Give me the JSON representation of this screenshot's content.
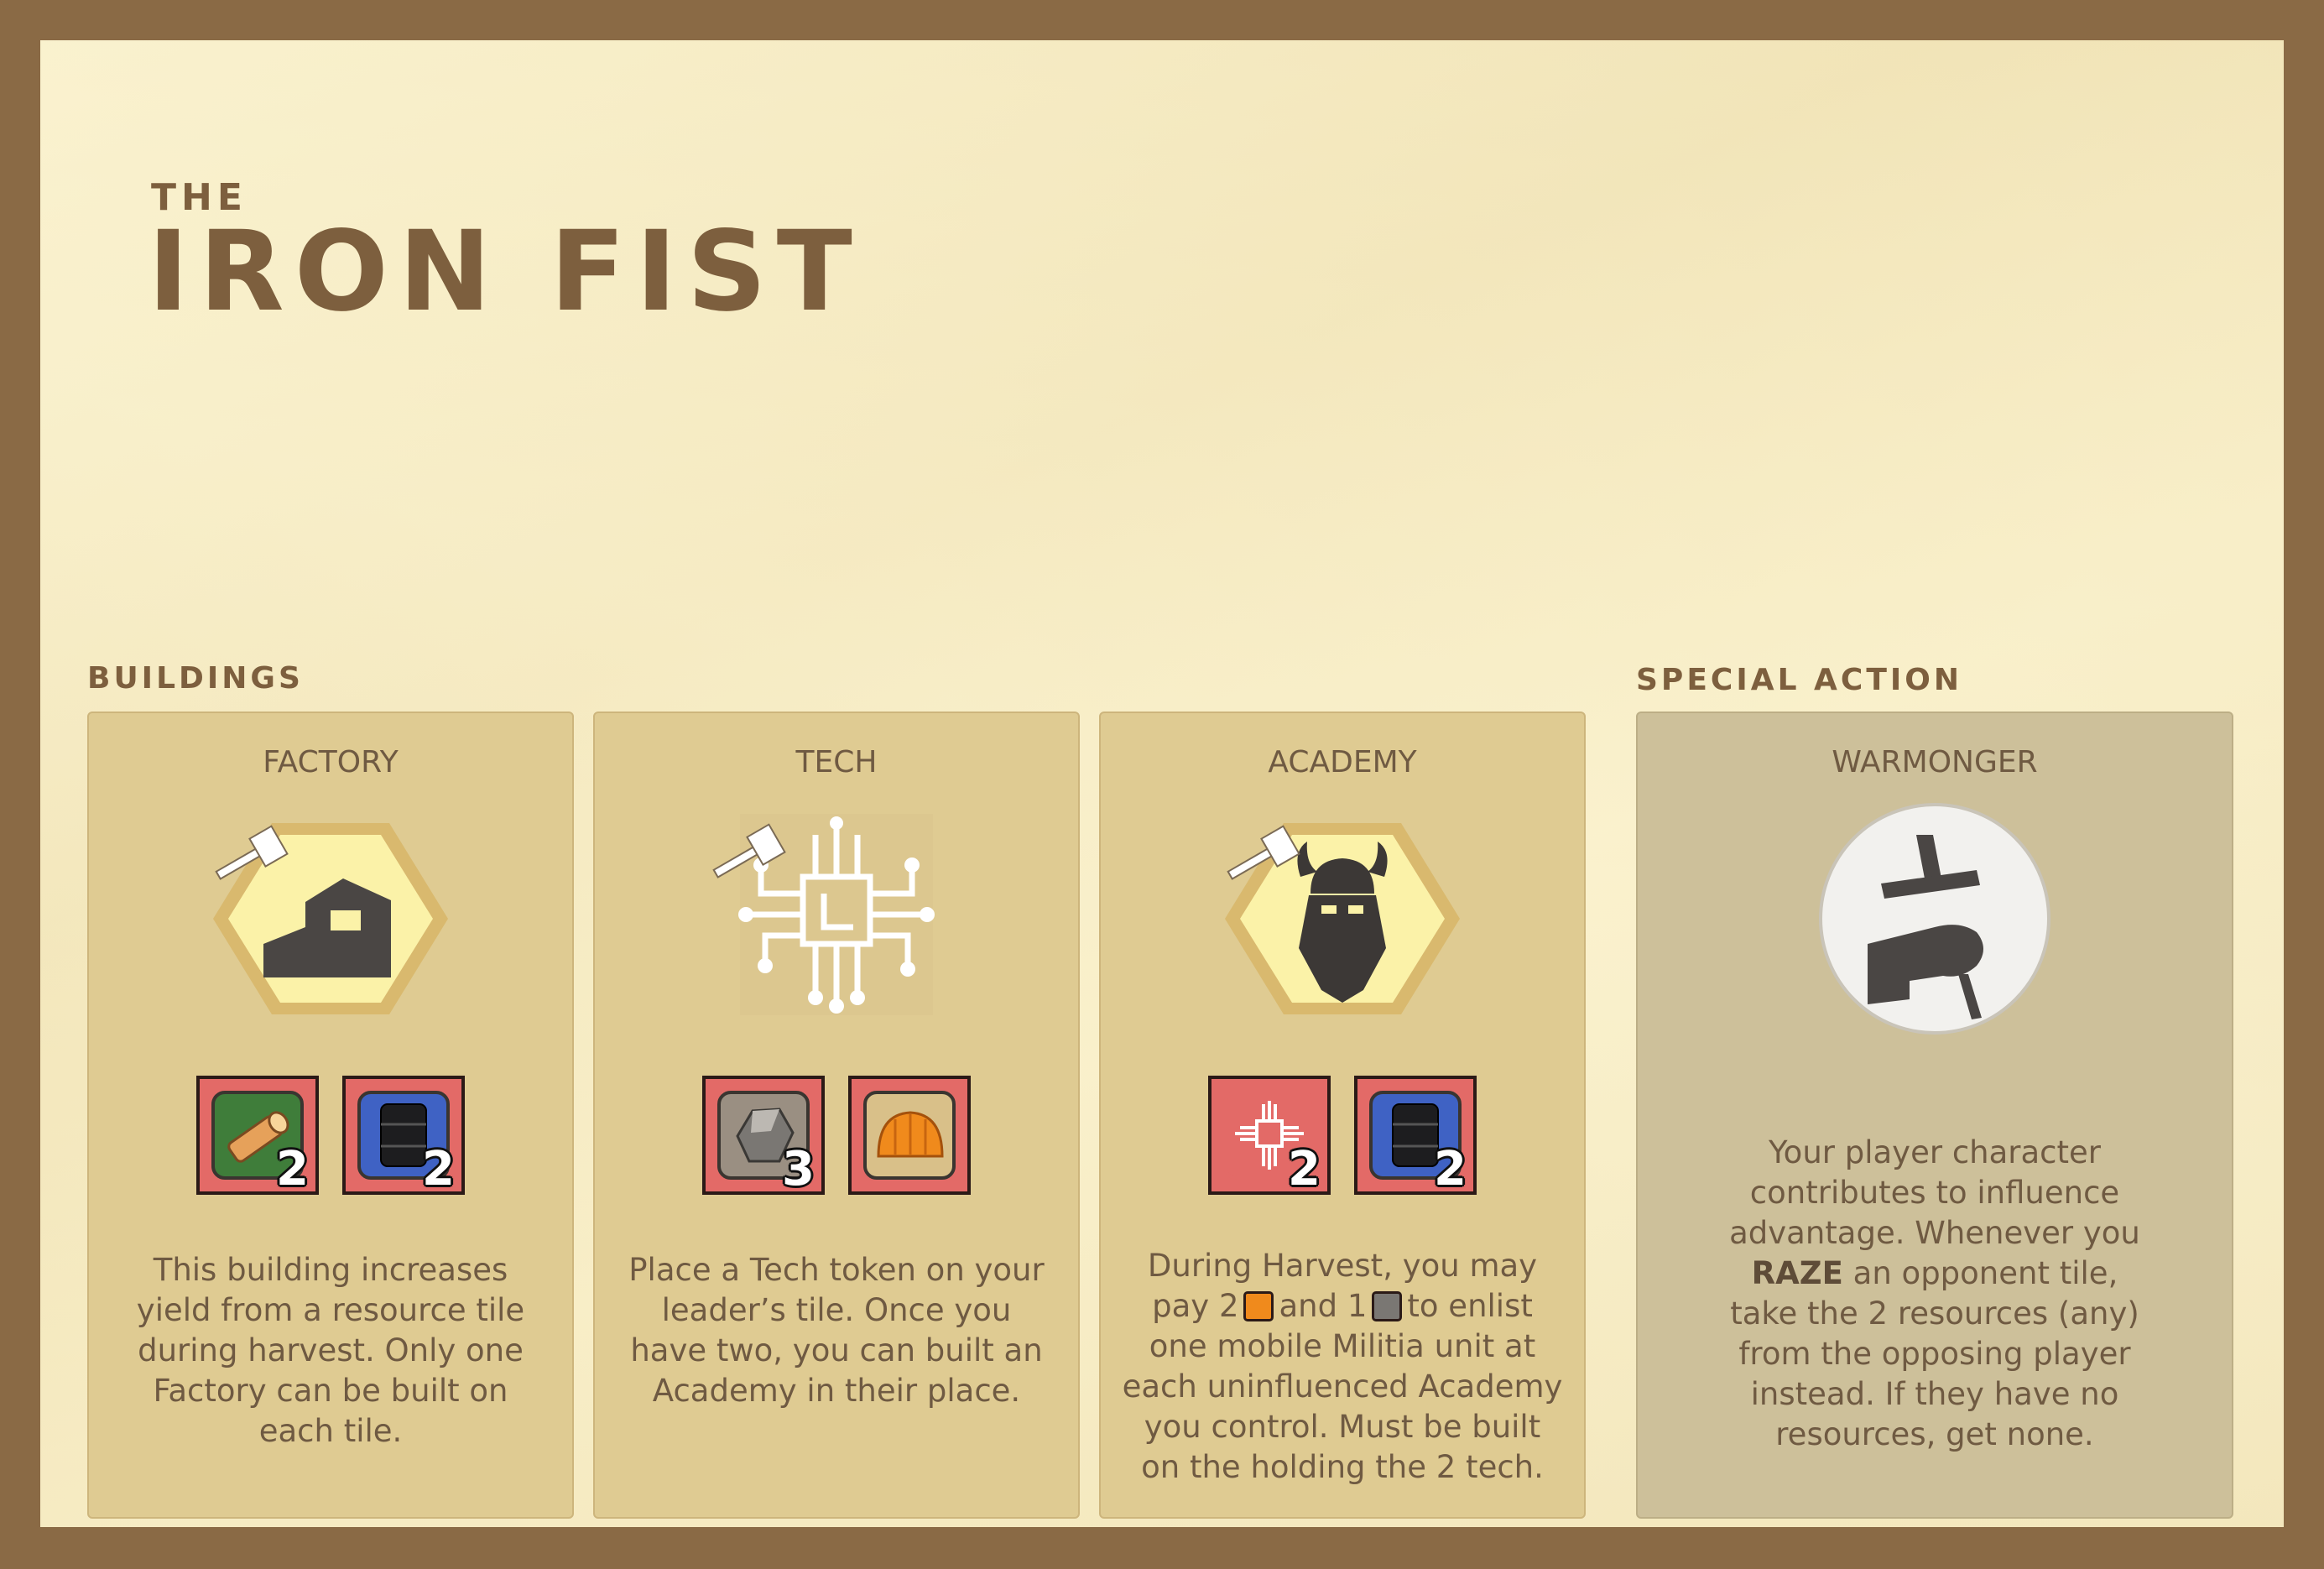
{
  "header": {
    "the": "THE",
    "title": "IRON FIST"
  },
  "sections": {
    "buildings": "BUILDINGS",
    "special": "SPECIAL ACTION"
  },
  "cards": {
    "factory": {
      "title": "FACTORY",
      "icon": "factory-hex-icon",
      "costs": [
        {
          "resource": "wood-log-icon",
          "count": "2"
        },
        {
          "resource": "oil-barrel-icon",
          "count": "2"
        }
      ],
      "desc": "This building increases yield from a resource tile during harvest. Only one Factory can be built on each tile."
    },
    "tech": {
      "title": "TECH",
      "icon": "circuit-chip-icon",
      "costs": [
        {
          "resource": "stone-ore-icon",
          "count": "3"
        },
        {
          "resource": "bread-loaf-icon",
          "count": ""
        }
      ],
      "desc": "Place a Tech token on your leader’s tile. Once you have two, you can built an Academy in their place."
    },
    "academy": {
      "title": "ACADEMY",
      "icon": "viking-warrior-hex-icon",
      "costs": [
        {
          "resource": "tech-token-icon",
          "count": "2"
        },
        {
          "resource": "oil-barrel-icon",
          "count": "2"
        }
      ],
      "desc_parts": {
        "a": "During Harvest, you may pay 2",
        "b": "and 1",
        "c": "to enlist one mobile Militia unit at each uninfluenced Academy you control. Must be built on the holding the 2 tech."
      }
    },
    "warmonger": {
      "title": "WARMONGER",
      "icon": "fist-holding-sword-icon",
      "desc_parts": {
        "a": "Your player character contributes to influence advantage. Whenever you",
        "bold": "RAZE",
        "b": "an opponent tile, take the 2 resources (any) from the opposing player instead. If they have no resources, get none."
      }
    }
  },
  "colors": {
    "frame": "#8a6a45",
    "sheet": "#f4e8bd",
    "card": "#dfcb92",
    "special_card": "#cdc09a",
    "cost_bg": "#e36a67",
    "text": "#6f5a42",
    "heading": "#7d5f3e"
  }
}
